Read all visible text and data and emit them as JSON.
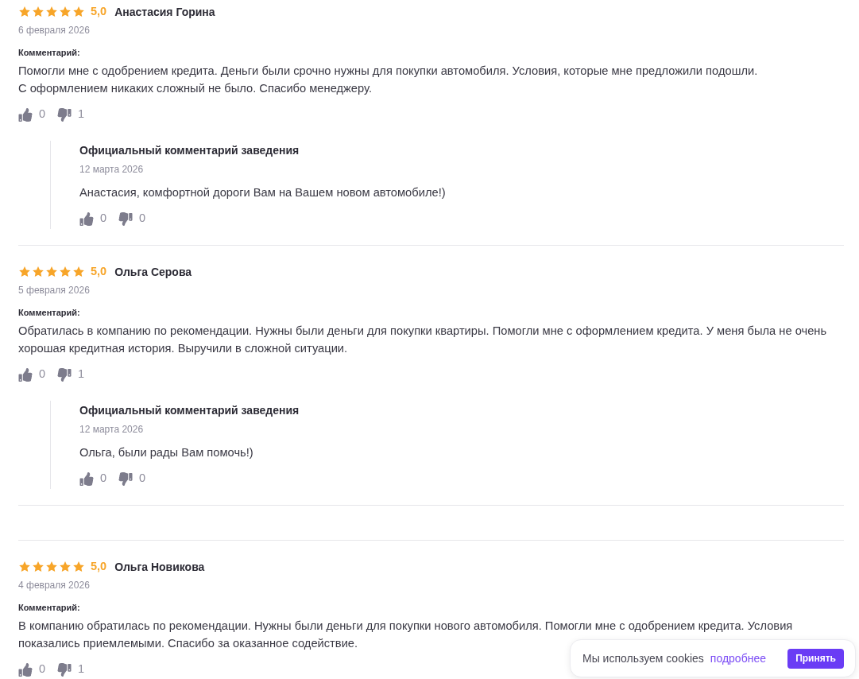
{
  "reviews": [
    {
      "stars": 5,
      "rating": "5,0",
      "author": "Анастасия Горина",
      "date": "6 февраля 2026",
      "comment_label": "Комментарий:",
      "text": "Помогли мне с одобрением кредита. Деньги были срочно нужны для покупки автомобиля. Условия, которые мне предложили подошли.\nС оформлением никаких сложный не было. Спасибо менеджеру.",
      "likes": "0",
      "dislikes": "1",
      "reply": {
        "title": "Официальный комментарий заведения",
        "date": "12 марта 2026",
        "text": "Анастасия, комфортной дороги Вам на Вашем новом автомобиле!)",
        "likes": "0",
        "dislikes": "0"
      }
    },
    {
      "stars": 5,
      "rating": "5,0",
      "author": "Ольга Серова",
      "date": "5 февраля 2026",
      "comment_label": "Комментарий:",
      "text": "Обратилась в компанию по рекомендации. Нужны были деньги для покупки квартиры. Помогли мне с оформлением кредита. У меня была не очень хорошая кредитная история. Выручили в сложной ситуации.",
      "likes": "0",
      "dislikes": "1",
      "reply": {
        "title": "Официальный комментарий заведения",
        "date": "12 марта 2026",
        "text": "Ольга, были рады Вам помочь!)",
        "likes": "0",
        "dislikes": "0"
      }
    },
    {
      "stars": 5,
      "rating": "5,0",
      "author": "Ольга Новикова",
      "date": "4 февраля 2026",
      "comment_label": "Комментарий:",
      "text": "В компанию обратилась по рекомендации. Нужны были деньги для покупки нового автомобиля. Помогли мне с одобрением кредита. Условия показались приемлемыми. Спасибо за оказанное содействие.",
      "likes": "0",
      "dislikes": "1"
    }
  ],
  "cookie_banner": {
    "text": "Мы используем cookies",
    "link": "подробнее",
    "button": "Принять"
  }
}
